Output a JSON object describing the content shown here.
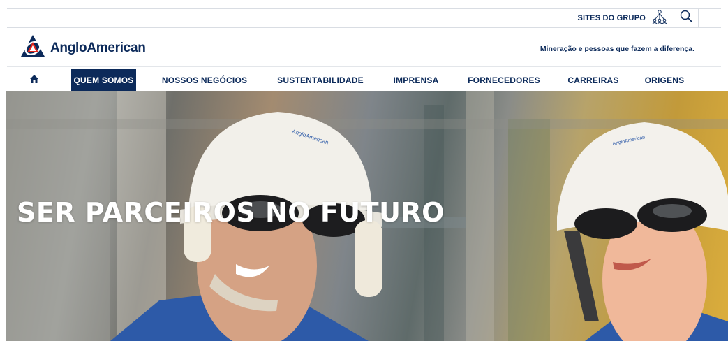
{
  "utility_bar": {
    "sites_label": "SITES DO GRUPO",
    "sites_icon": "network-people-icon",
    "search_icon": "search-icon"
  },
  "brand": {
    "logo_name": "AngloAmerican",
    "logo_icon": "anglo-american-logo",
    "tagline": "Mineração e pessoas que fazem a diferença."
  },
  "nav": {
    "home_icon": "home-icon",
    "items": [
      {
        "label": "QUEM SOMOS",
        "active": true
      },
      {
        "label": "NOSSOS NEGÓCIOS",
        "active": false
      },
      {
        "label": "SUSTENTABILIDADE",
        "active": false
      },
      {
        "label": "IMPRENSA",
        "active": false
      },
      {
        "label": "FORNECEDORES",
        "active": false
      },
      {
        "label": "CARREIRAS",
        "active": false
      },
      {
        "label": "ORIGENS",
        "active": false
      }
    ]
  },
  "hero": {
    "title": "SER PARCEIROS NO FUTURO",
    "helmet_text": "AngloAmerican"
  },
  "colors": {
    "brand_navy": "#0c2a5a",
    "brand_red": "#e2231a",
    "white": "#ffffff"
  }
}
